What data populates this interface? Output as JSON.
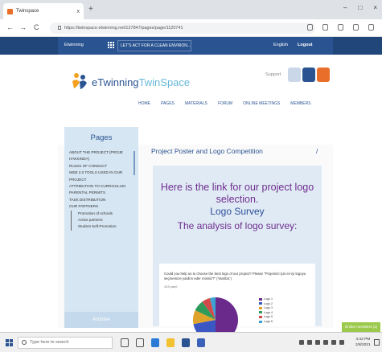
{
  "browser": {
    "tab_title": "Twinspace",
    "tab_close": "x",
    "new_tab": "+",
    "window_controls": [
      "–",
      "□",
      "×"
    ],
    "url": "https://twinspace.etwinning.net/127847/pages/page/1120741",
    "nav": {
      "back": "←",
      "forward": "→",
      "refresh": "C"
    }
  },
  "site": {
    "brand": "Etwinning",
    "project_selector": "LET'S ACT FOR A CLEAN ENVIRON...",
    "language": "English",
    "logout": "Logout",
    "logo_text_1": "eTwinning",
    "logo_text_2": "TwinSpace",
    "support": "Support",
    "nav_items": [
      "HOME",
      "PAGES",
      "MATERIALS",
      "FORUM",
      "ONLINE MEETINGS",
      "MEMBERS"
    ]
  },
  "sidebar": {
    "title": "Pages",
    "items": [
      "ABOUT THE PROJECT (PROJE HAKKINDA)",
      "RULES OF CONDUCT",
      "WEB 2.0 TOOLS USED IN OUR PROJECT",
      "ATTRIBUTION TO CURRICULUM",
      "PARENTAL PERMITS",
      "TASK DISTRIBUTION",
      "OUR PARTNERS"
    ],
    "sub_items": [
      "Promotion of schools",
      "Active partners",
      "Student Self-Promotion"
    ],
    "archive": "Archive"
  },
  "main": {
    "page_title": "Project Poster and Logo Competition",
    "edit_icon": "/",
    "headline": "Here is the link for our project logo selection.",
    "link1": "Logo Survey",
    "link2": "The analysis of logo survey:",
    "survey_question": "Could you help us to choose the best logo of our project? Please \"Projemizi için en iyi logoyu seçmemize yardım eder misiniz?\" (Yanıtlar:)",
    "survey_count": "415 yanıt"
  },
  "chart_data": {
    "type": "pie",
    "categories": [
      "Logo 1",
      "Logo 2",
      "Logo 3",
      "Logo 4",
      "Logo 5",
      "Logo 6"
    ],
    "values": [
      50,
      22,
      10,
      8,
      6,
      4
    ],
    "colors": [
      "#6a2a8c",
      "#3b57c4",
      "#e0a32a",
      "#2f9a5a",
      "#d24a4a",
      "#3aa3d4"
    ]
  },
  "chat": {
    "online_members": "Online members (1)"
  },
  "taskbar": {
    "search_placeholder": "Type here to search",
    "time": "4:42 PM",
    "date": "2/8/2021"
  }
}
